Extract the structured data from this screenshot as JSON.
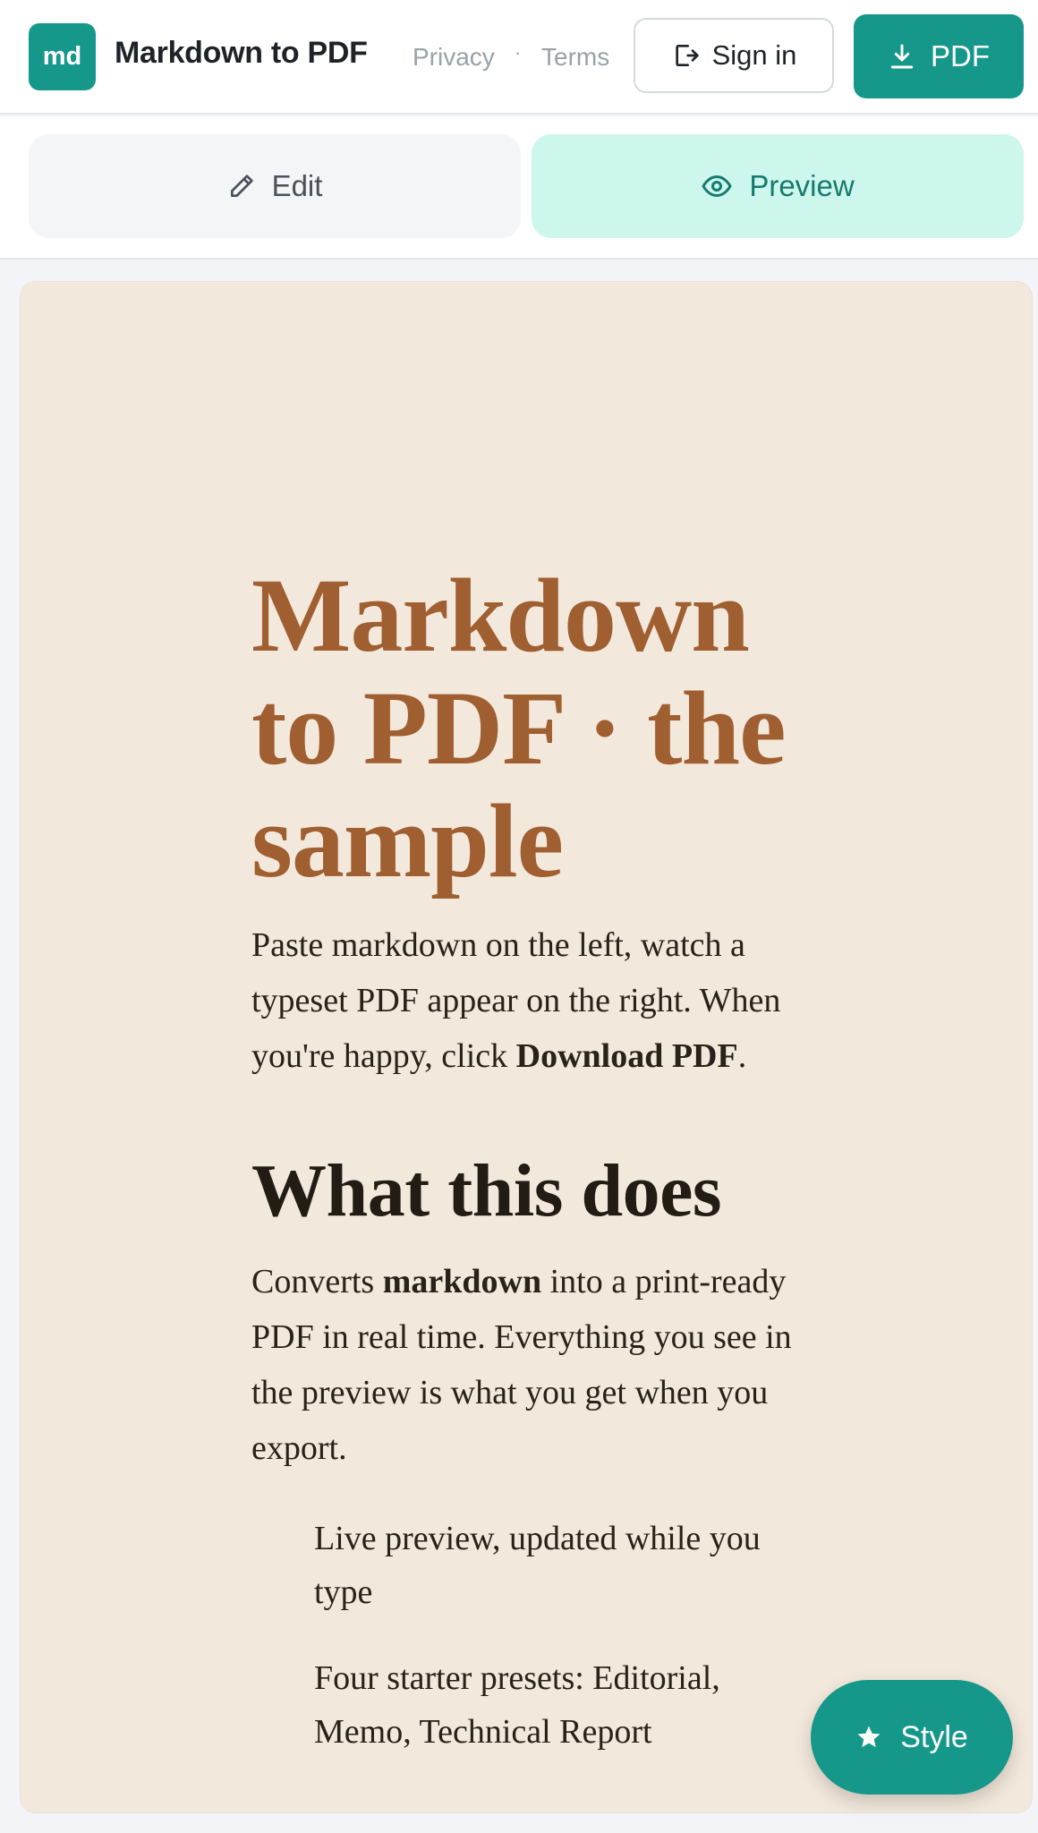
{
  "header": {
    "logo_text": "md",
    "title": "Markdown to PDF",
    "nav": {
      "privacy": "Privacy",
      "separator": "·",
      "terms": "Terms"
    },
    "signin_label": "Sign in",
    "download_label": "PDF",
    "accent_color": "#15978a"
  },
  "tabs": {
    "edit_label": "Edit",
    "preview_label": "Preview",
    "active": "preview"
  },
  "document": {
    "title": "Markdown to PDF · the sample",
    "intro_text": "Paste markdown on the left, watch a typeset PDF appear on the right. When you're happy, click ",
    "intro_bold": "Download PDF",
    "intro_end": ".",
    "section_heading": "What this does",
    "section_p_start": "Converts ",
    "section_p_bold": "markdown",
    "section_p_rest": " into a print-ready PDF in real time. Everything you see in the preview is what you get when you export.",
    "list_items": [
      "Live preview, updated while you type",
      "Four starter presets: Editorial, Memo, Technical Report"
    ],
    "title_color": "#a05f31",
    "page_background": "#f3e8dc"
  },
  "fab": {
    "label": "Style",
    "icon": "star-icon"
  }
}
